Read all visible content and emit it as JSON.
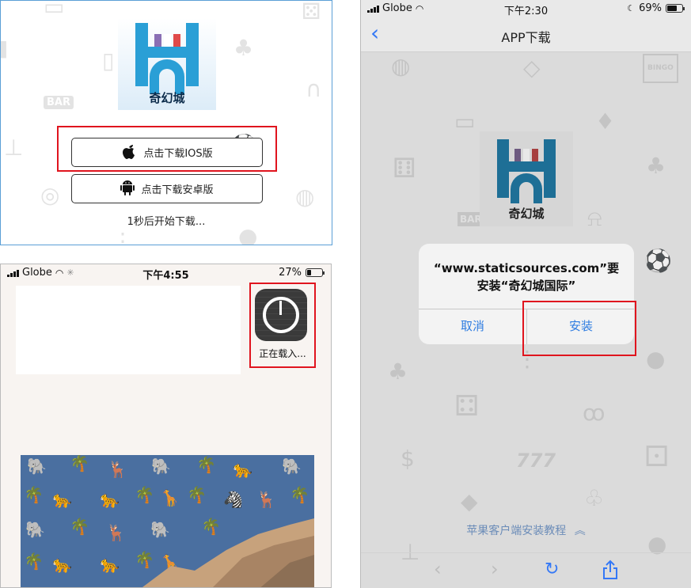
{
  "download_page": {
    "logo_text": "奇幻城",
    "ios_button": "点击下载IOS版",
    "android_button": "点击下载安卓版",
    "countdown": "1秒后开始下载...",
    "bg_badge": "BAR"
  },
  "home_screen": {
    "status": {
      "carrier": "Globe",
      "time": "下午4:55",
      "battery": "27%",
      "battery_level": 0.27
    },
    "app_label": "正在载入...",
    "loading_progress": 0.0
  },
  "install_screen": {
    "status": {
      "carrier": "Globe",
      "time": "下午2:30",
      "battery": "69%",
      "battery_level": 0.69
    },
    "nav_title": "APP下载",
    "logo_text": "奇幻城",
    "bg_badges": [
      "BINGO",
      "BAR"
    ],
    "alert": {
      "line1": "“www.staticsources.com”要",
      "line2": "安装“奇幻城国际”",
      "cancel": "取消",
      "install": "安装"
    },
    "tutorial_link": "苹果客户端安装教程",
    "toolbar": [
      "back-arrow-icon",
      "forward-arrow-icon",
      "reload-icon",
      "share-icon"
    ]
  },
  "colors": {
    "highlight": "#e0141e",
    "ios_blue": "#2f7de1",
    "logo_blue": "#2a9fd6",
    "logo_purple": "#8a6fb4",
    "logo_red": "#e04a4a",
    "wallpaper_blue": "#4a6fa0",
    "wallpaper_gold": "#d4a93a"
  }
}
